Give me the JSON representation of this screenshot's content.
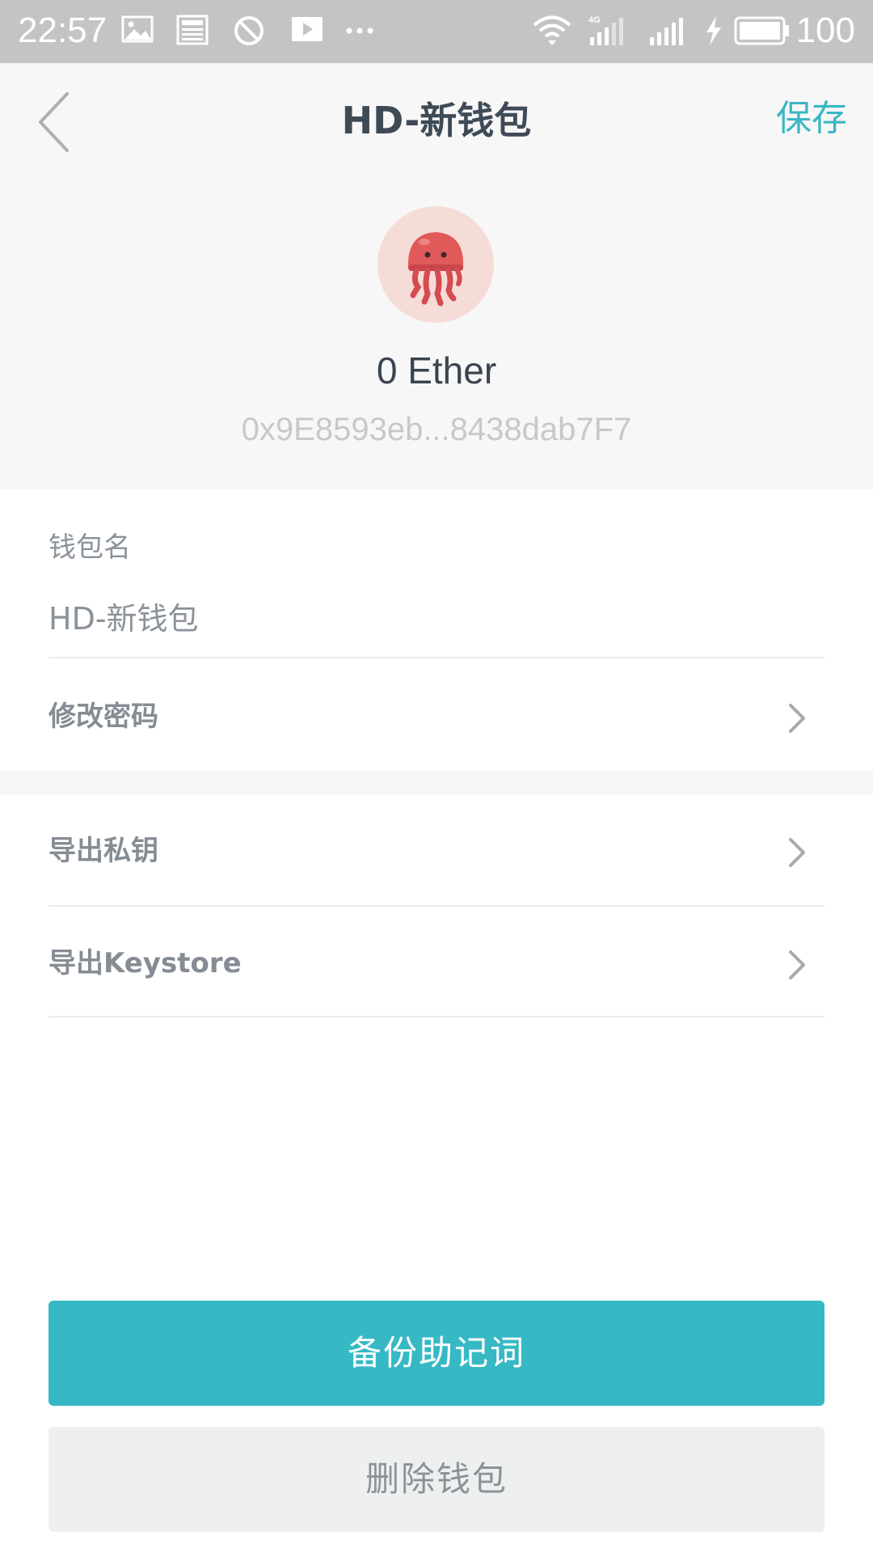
{
  "status_bar": {
    "time": "22:57",
    "battery_level": "100",
    "icons": [
      "image-icon",
      "news-icon",
      "block-icon",
      "play-icon",
      "more-dots-icon",
      "wifi-icon",
      "signal-4g-icon",
      "signal-icon",
      "charging-icon",
      "battery-icon"
    ]
  },
  "header": {
    "back_icon": "chevron-left-icon",
    "title": "HD-新钱包",
    "save_label": "保存"
  },
  "wallet": {
    "avatar_icon": "jellyfish-icon",
    "balance": "0 Ether",
    "address": "0x9E8593eb...8438dab7F7"
  },
  "form": {
    "name_label": "钱包名",
    "name_value": "HD-新钱包",
    "change_password_label": "修改密码"
  },
  "export": {
    "private_key_label": "导出私钥",
    "keystore_label": "导出Keystore"
  },
  "actions": {
    "backup_label": "备份助记词",
    "delete_label": "删除钱包"
  },
  "colors": {
    "accent": "#36b9c5",
    "title_text": "#3f4a57",
    "muted_text": "#8b9299",
    "header_bg": "#f7f7f7",
    "avatar_bg": "#f6dcd7",
    "jellyfish": "#e05a5a"
  }
}
